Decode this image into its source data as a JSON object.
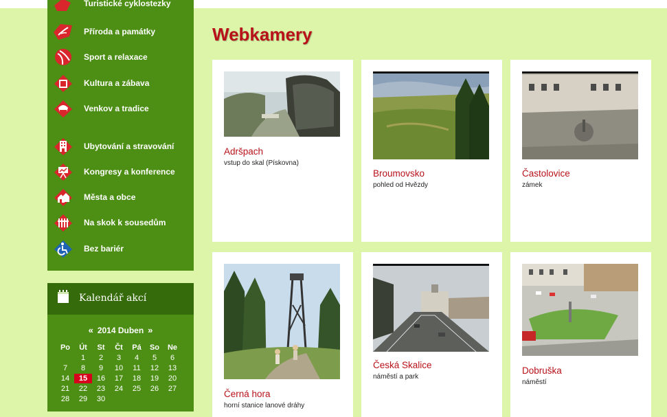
{
  "menu": {
    "partial_top_label": "Turistické cyklostezky",
    "items": [
      {
        "label": "Příroda a památky",
        "icon": "leaf-icon"
      },
      {
        "label": "Sport a relaxace",
        "icon": "ball-icon"
      },
      {
        "label": "Kultura a zábava",
        "icon": "theater-icon"
      },
      {
        "label": "Venkov a tradice",
        "icon": "hat-icon"
      },
      {
        "label": "Ubytování a stravování",
        "icon": "building-icon"
      },
      {
        "label": "Kongresy a konference",
        "icon": "presentation-icon"
      },
      {
        "label": "Města a obce",
        "icon": "houses-icon"
      },
      {
        "label": "Na skok k sousedům",
        "icon": "fence-icon"
      },
      {
        "label": "Bez bariér",
        "icon": "wheelchair-icon"
      }
    ]
  },
  "calendar": {
    "title": "Kalendář akcí",
    "prev": "«",
    "next": "»",
    "month_label": "2014 Duben",
    "weekdays": [
      "Po",
      "Út",
      "St",
      "Čt",
      "Pá",
      "So",
      "Ne"
    ],
    "today": "15",
    "weeks": [
      [
        "",
        "1",
        "2",
        "3",
        "4",
        "5",
        "6"
      ],
      [
        "7",
        "8",
        "9",
        "10",
        "11",
        "12",
        "13"
      ],
      [
        "14",
        "15",
        "16",
        "17",
        "18",
        "19",
        "20"
      ],
      [
        "21",
        "22",
        "23",
        "24",
        "25",
        "26",
        "27"
      ],
      [
        "28",
        "29",
        "30",
        "",
        "",
        "",
        ""
      ]
    ]
  },
  "page": {
    "title": "Webkamery"
  },
  "cameras": [
    {
      "name": "Adršpach",
      "description": "vstup do skal (Pískovna)"
    },
    {
      "name": "Broumovsko",
      "description": "pohled od Hvězdy"
    },
    {
      "name": "Častolovice",
      "description": "zámek"
    },
    {
      "name": "Černá hora",
      "description": "horní stanice lanové dráhy"
    },
    {
      "name": "Česká Skalice",
      "description": "náměstí a park"
    },
    {
      "name": "Dobruška",
      "description": "náměstí"
    }
  ],
  "colors": {
    "page_bg": "#ddf5a9",
    "sidebar_green": "#4c8f14",
    "accent_red": "#b8111a",
    "today_red": "#d6001c"
  }
}
